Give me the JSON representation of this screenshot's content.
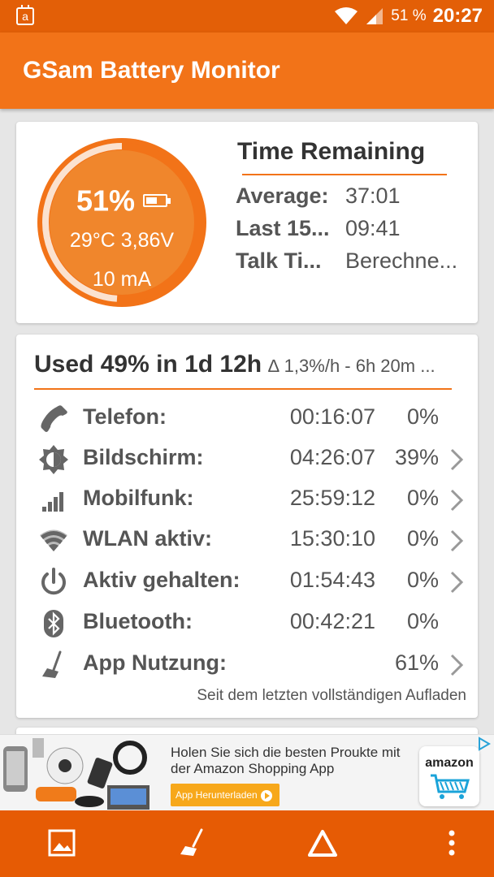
{
  "status_bar": {
    "notification_icon": "calendar-icon",
    "notification_letter": "a",
    "battery_percent": "51 %",
    "time": "20:27",
    "icons": [
      "wifi-icon",
      "cell-signal-icon"
    ]
  },
  "app_bar": {
    "title": "GSam Battery Monitor"
  },
  "gauge": {
    "percent_label": "51%",
    "level": 0.51,
    "temp_voltage": "29°C  3,86V",
    "current": "10 mA",
    "icon": "battery-icon"
  },
  "time_remaining": {
    "title": "Time Remaining",
    "rows": [
      {
        "label": "Average:",
        "value": "37:01"
      },
      {
        "label": "Last 15...",
        "value": "09:41"
      },
      {
        "label": "Talk Ti...",
        "value": "Berechne..."
      }
    ]
  },
  "usage": {
    "title": "Used 49% in 1d 12h",
    "subtitle": "∆ 1,3%/h - 6h 20m ...",
    "rows": [
      {
        "icon": "phone-icon",
        "label": "Telefon:",
        "time": "00:16:07",
        "percent": "0%",
        "has_detail": false
      },
      {
        "icon": "brightness-icon",
        "label": "Bildschirm:",
        "time": "04:26:07",
        "percent": "39%",
        "has_detail": true
      },
      {
        "icon": "signal-bars-icon",
        "label": "Mobilfunk:",
        "time": "25:59:12",
        "percent": "0%",
        "has_detail": true
      },
      {
        "icon": "wifi-icon",
        "label": "WLAN aktiv:",
        "time": "15:30:10",
        "percent": "0%",
        "has_detail": true
      },
      {
        "icon": "power-icon",
        "label": "Aktiv gehalten:",
        "time": "01:54:43",
        "percent": "0%",
        "has_detail": true
      },
      {
        "icon": "bluetooth-icon",
        "label": "Bluetooth:",
        "time": "00:42:21",
        "percent": "0%",
        "has_detail": false
      },
      {
        "icon": "broom-icon",
        "label": "App Nutzung:",
        "time": "",
        "percent": "61%",
        "has_detail": true
      }
    ],
    "footnote": "Seit dem letzten vollständigen Aufladen"
  },
  "ad": {
    "text": "Holen Sie sich die besten Proukte mit der Amazon Shopping App",
    "button_label": "App Herunterladen",
    "logo_text": "amazon",
    "colors": {
      "button": "#f7a81b"
    }
  },
  "bottom_nav": {
    "items": [
      "image-icon",
      "broom-icon",
      "delta-icon",
      "more-vert-icon"
    ]
  },
  "colors": {
    "accent": "#f27318",
    "status_bar": "#e35f07",
    "bottom_bar": "#e65b04"
  }
}
